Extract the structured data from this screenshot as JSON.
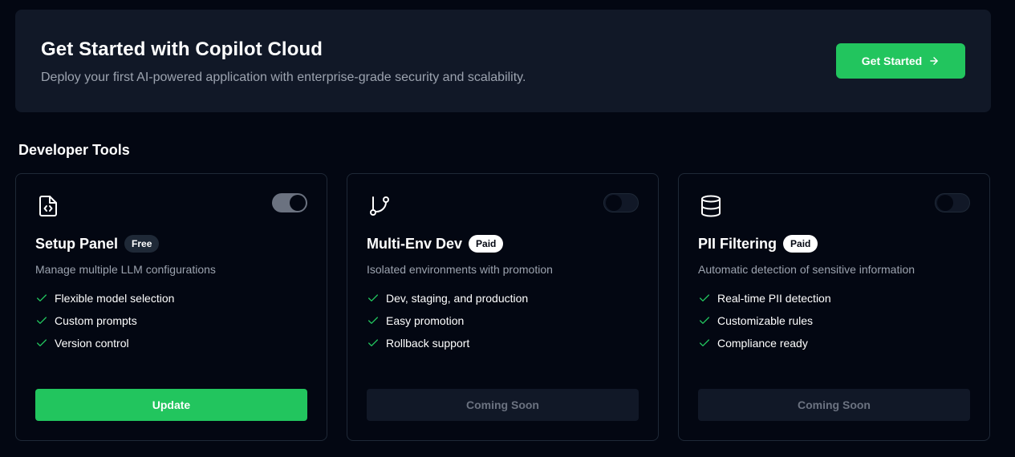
{
  "hero": {
    "title": "Get Started with Copilot Cloud",
    "subtitle": "Deploy your first AI-powered application with enterprise-grade security and scalability.",
    "button_label": "Get Started",
    "button_icon": "arrow-right-icon"
  },
  "section": {
    "title": "Developer Tools"
  },
  "colors": {
    "background": "#030712",
    "surface": "#111827",
    "border": "#1f2937",
    "accent": "#22c55e",
    "muted_text": "#9ca3af"
  },
  "cards": [
    {
      "icon": "file-code-icon",
      "title": "Setup Panel",
      "badge": "Free",
      "toggle_on": true,
      "description": "Manage multiple LLM configurations",
      "features": [
        "Flexible model selection",
        "Custom prompts",
        "Version control"
      ],
      "button_label": "Update",
      "button_enabled": true
    },
    {
      "icon": "git-branch-icon",
      "title": "Multi-Env Dev",
      "badge": "Paid",
      "toggle_on": false,
      "description": "Isolated environments with promotion",
      "features": [
        "Dev, staging, and production",
        "Easy promotion",
        "Rollback support"
      ],
      "button_label": "Coming Soon",
      "button_enabled": false
    },
    {
      "icon": "database-icon",
      "title": "PII Filtering",
      "badge": "Paid",
      "toggle_on": false,
      "description": "Automatic detection of sensitive information",
      "features": [
        "Real-time PII detection",
        "Customizable rules",
        "Compliance ready"
      ],
      "button_label": "Coming Soon",
      "button_enabled": false
    }
  ]
}
